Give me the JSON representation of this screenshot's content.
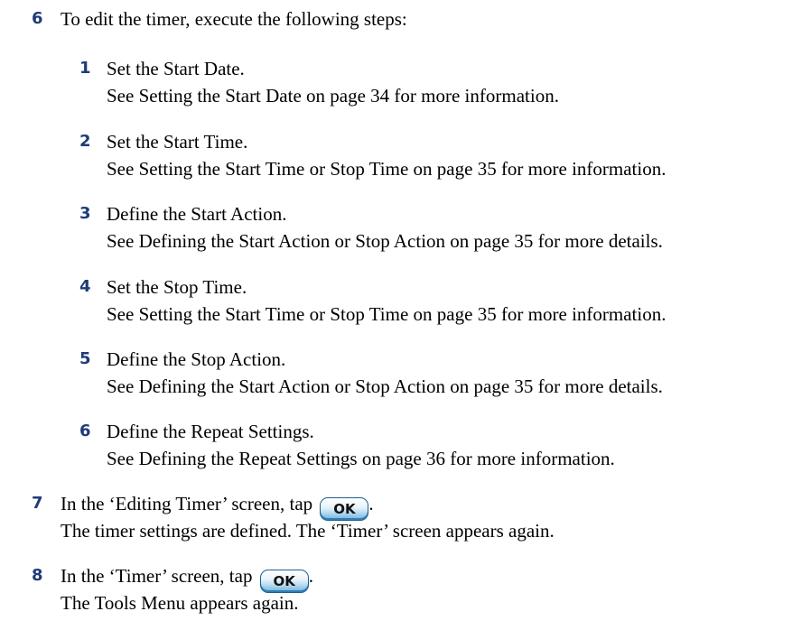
{
  "steps": [
    {
      "num": "6",
      "text": "To edit the timer, execute the following steps:"
    },
    {
      "num": "1",
      "line1": "Set the Start Date.",
      "line2": "See Setting the Start Date on page 34 for more information."
    },
    {
      "num": "2",
      "line1": "Set the Start Time.",
      "line2": "See Setting the Start Time or Stop Time on page 35 for more information."
    },
    {
      "num": "3",
      "line1": "Define the Start Action.",
      "line2": "See Defining the Start Action or Stop Action on page 35 for more details."
    },
    {
      "num": "4",
      "line1": "Set the Stop Time.",
      "line2": "See Setting the Start Time or Stop Time on page 35 for more information."
    },
    {
      "num": "5",
      "line1": "Define the Stop Action.",
      "line2": "See Defining the Start Action or Stop Action on page 35 for more details."
    },
    {
      "num": "6",
      "line1": "Define the Repeat Settings.",
      "line2": "See Defining the Repeat Settings on page 36 for more information."
    },
    {
      "num": "7",
      "line1_before": "In the ‘Editing Timer’ screen, tap",
      "button": "OK",
      "line1_after": ".",
      "line2": "The timer settings are defined. The ‘Timer’ screen appears again."
    },
    {
      "num": "8",
      "line1_before": "In the ‘Timer’ screen, tap",
      "button": "OK",
      "line1_after": ".",
      "line2": "The Tools Menu appears again."
    }
  ],
  "colors": {
    "step_number": "#1f3b78",
    "button_border": "#1f5f8f"
  }
}
